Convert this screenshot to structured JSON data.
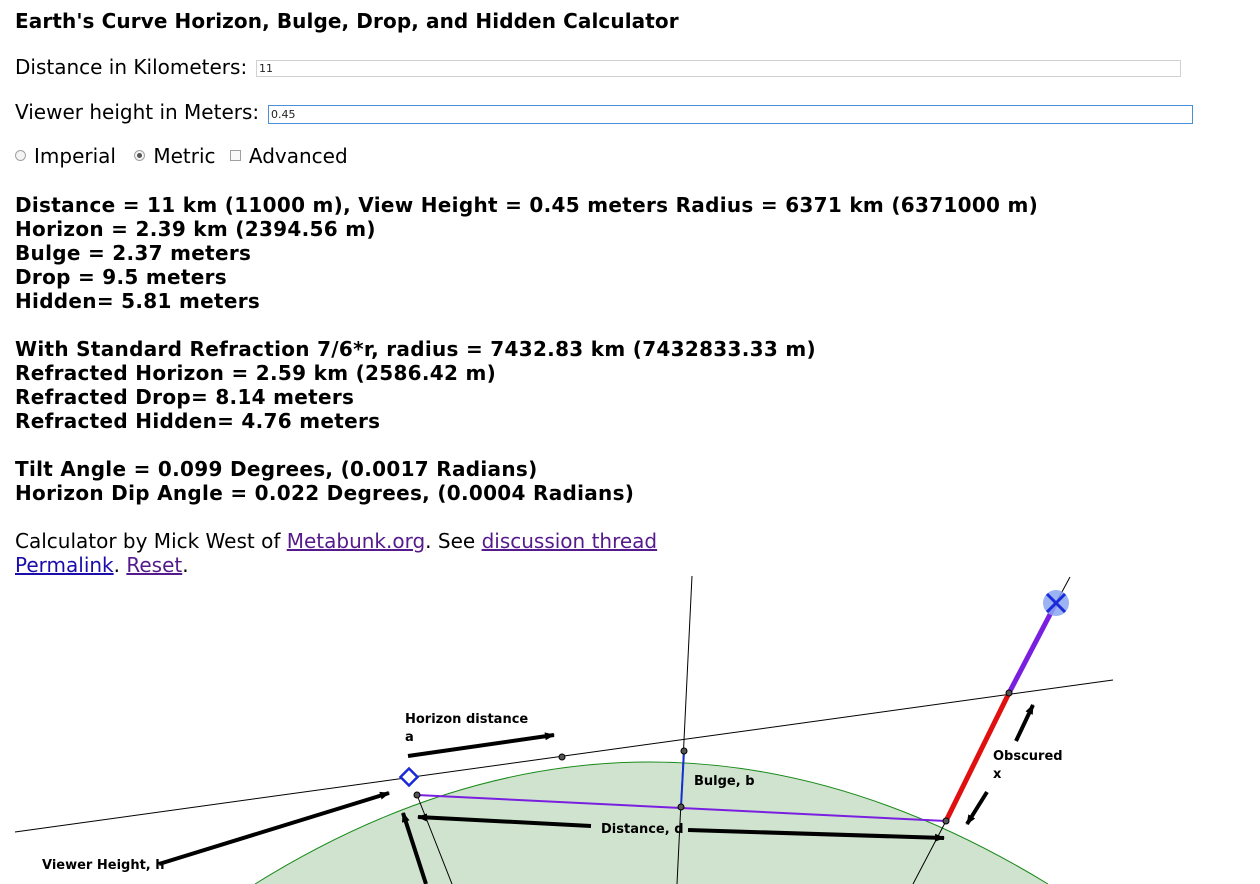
{
  "title": "Earth's Curve Horizon, Bulge, Drop, and Hidden Calculator",
  "inputs": {
    "distance_label": "Distance in Kilometers:",
    "distance_value": "11",
    "height_label": "Viewer height in Meters:",
    "height_value": "0.45"
  },
  "options": {
    "imperial": "Imperial",
    "metric": "Metric",
    "advanced": "Advanced",
    "selected": "Metric",
    "advanced_checked": false
  },
  "results": {
    "summary": "Distance = 11 km (11000 m), View Height = 0.45 meters Radius = 6371 km (6371000 m)",
    "horizon": "Horizon = 2.39 km (2394.56 m)",
    "bulge": "Bulge = 2.37 meters",
    "drop": "Drop = 9.5 meters",
    "hidden": "Hidden= 5.81 meters",
    "refraction": "With Standard Refraction 7/6*r, radius = 7432.83 km (7432833.33 m)",
    "refracted_horizon": "Refracted Horizon = 2.59 km (2586.42 m)",
    "refracted_drop": "Refracted Drop= 8.14 meters",
    "refracted_hidden": "Refracted Hidden= 4.76 meters",
    "tilt": "Tilt Angle = 0.099 Degrees, (0.0017 Radians)",
    "dip": "Horizon Dip Angle = 0.022 Degrees, (0.0004 Radians)"
  },
  "credit": {
    "prefix": "Calculator by Mick West of ",
    "site_link": "Metabunk.org",
    "middle": ". See ",
    "thread_link": "discussion thread",
    "permalink": "Permalink",
    "sep": ". ",
    "reset": "Reset",
    "end": "."
  },
  "diagram": {
    "label_horizon_1": "Horizon distance",
    "label_horizon_2": "a",
    "label_bulge": "Bulge, b",
    "label_obscured_1": "Obscured",
    "label_obscured_2": "x",
    "label_distance": "Distance, d",
    "label_viewer": "Viewer Height, h",
    "colors": {
      "earth_fill": "#cfe3cf",
      "earth_stroke": "#1a8a1a",
      "chord": "#7a1fe0",
      "bulge_line": "#1530d0",
      "obscured": "#e01010",
      "viewer": "#1a2ad8",
      "target_fill": "#8aa6f0"
    }
  }
}
